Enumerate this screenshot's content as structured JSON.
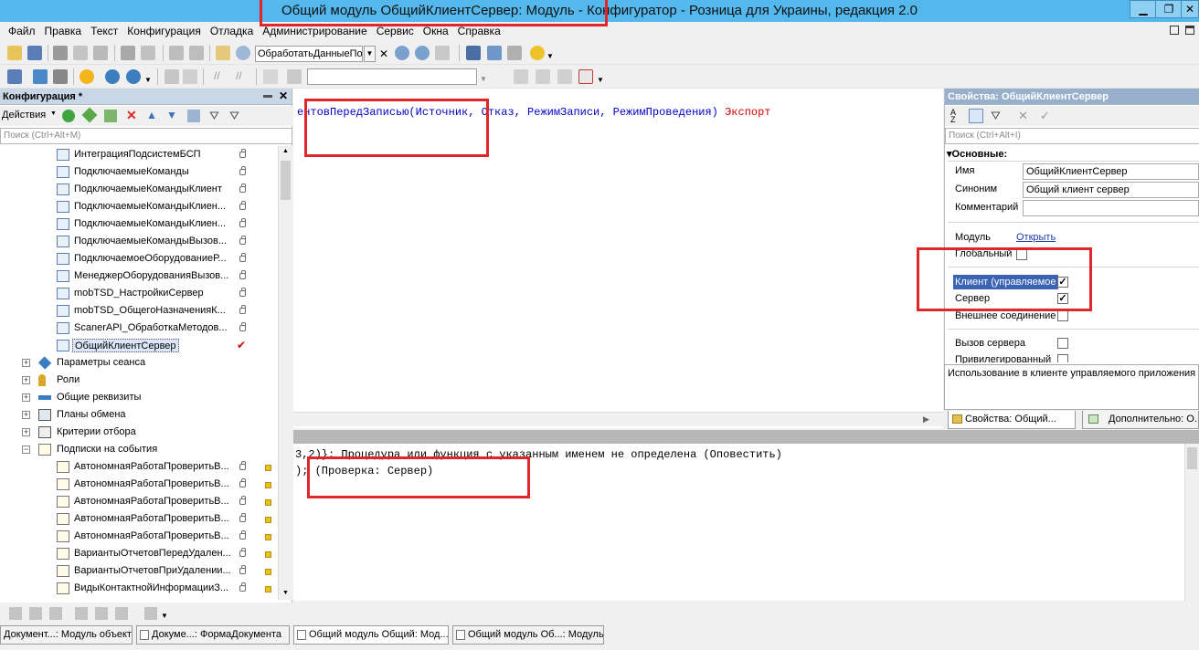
{
  "window": {
    "title": "Общий модуль ОбщийКлиентСервер: Модуль - Конфигуратор - Розница для Украины, редакция 2.0",
    "minimize": "▁",
    "restore": "❐",
    "close": "✕"
  },
  "menu": [
    "Файл",
    "Правка",
    "Текст",
    "Конфигурация",
    "Отладка",
    "Администрирование",
    "Сервис",
    "Окна",
    "Справка"
  ],
  "toolbar": {
    "procedure_combo": "ОбработатьДанныеПо",
    "empty_combo": ""
  },
  "config_panel": {
    "title": "Конфигурация *",
    "actions_label": "Действия",
    "search_placeholder": "Поиск (Ctrl+Alt+M)",
    "modules": [
      "ИнтеграцияПодсистемБСП",
      "ПодключаемыеКоманды",
      "ПодключаемыеКомандыКлиент",
      "ПодключаемыеКомандыКлиен...",
      "ПодключаемыеКомандыКлиен...",
      "ПодключаемыеКомандыВызов...",
      "ПодключаемоеОборудованиеР...",
      "МенеджерОборудованияВызов...",
      "mobTSD_НастройкиСервер",
      "mobTSD_ОбщегоНазначенияК...",
      "ScanerAPI_ОбработкаМетодов...",
      "ОбщийКлиентСервер"
    ],
    "groups": [
      "Параметры сеанса",
      "Роли",
      "Общие реквизиты",
      "Планы обмена",
      "Критерии отбора",
      "Подписки на события"
    ],
    "subscriptions": [
      "АвтономнаяРаботаПроверитьВ...",
      "АвтономнаяРаботаПроверитьВ...",
      "АвтономнаяРаботаПроверитьВ...",
      "АвтономнаяРаботаПроверитьВ...",
      "АвтономнаяРаботаПроверитьВ...",
      "ВариантыОтчетовПередУдален...",
      "ВариантыОтчетовПриУдалении...",
      "ВидыКонтактнойИнформацииЗ..."
    ]
  },
  "editor": {
    "line_name": "ентовПередЗаписью",
    "line_params": "(Источник, Отказ, РежимЗаписи, РежимПроведения)",
    "line_export": "Экспорт"
  },
  "messages": {
    "line1": "3,2)}: Процедура или функция с указанным именем не определена (Оповестить)",
    "line2": "); (Проверка: Сервер)"
  },
  "properties": {
    "title": "Свойства: ОбщийКлиентСервер",
    "search_placeholder": "Поиск (Ctrl+Alt+I)",
    "section": "Основные:",
    "name_label": "Имя",
    "name_value": "ОбщийКлиентСервер",
    "synonym_label": "Синоним",
    "synonym_value": "Общий клиент сервер",
    "comment_label": "Комментарий",
    "comment_value": "",
    "module_label": "Модуль",
    "module_link": "Открыть",
    "global_label": "Глобальный",
    "client_label": "Клиент (управляемое",
    "server_label": "Сервер",
    "external_label": "Внешнее соединение",
    "server_call_label": "Вызов сервера",
    "privileged_label": "Привилегированный",
    "description": "Использование в клиенте управляемого приложения",
    "tab1": "Свойства: Общий...",
    "tab2": "Дополнительно: О..."
  },
  "taskbar": [
    "Документ...: Модуль объекта",
    "Докуме...: ФормаДокумента",
    "Общий модуль Общий: Мод...",
    "Общий модуль Об...: Модуль"
  ],
  "colors": {
    "title_bar": "#55b8ec",
    "highlight": "#e0252b",
    "selection": "#3a63b5",
    "keyword": "#d40000",
    "identifier": "#0000c8"
  }
}
